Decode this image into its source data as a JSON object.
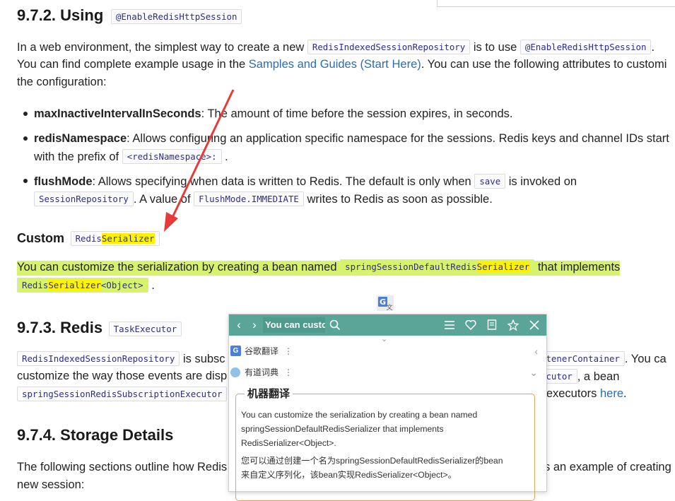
{
  "doc": {
    "h_972_prefix": "9.7.2. Using",
    "h_972_code": "@EnableRedisHttpSession",
    "p1_a": "In a web environment, the simplest way to create a new",
    "p1_code1": "RedisIndexedSessionRepository",
    "p1_b": "is to use",
    "p1_code2": "@EnableRedisHttpSession",
    "p1_c": ".",
    "p1_line2_a": "You can find complete example usage in the",
    "p1_link": "Samples and Guides (Start Here)",
    "p1_line2_b": ". You can use the following attributes to customi",
    "p1_line3": "the configuration:",
    "b1_bold": "maxInactiveIntervalInSeconds",
    "b1_text": ": The amount of time before the session expires, in seconds.",
    "b2_bold": "redisNamespace",
    "b2_text": ": Allows configuring an application specific namespace for the sessions. Redis keys and channel IDs start",
    "b2_line2_a": "with the prefix of",
    "b2_code": "<redisNamespace>:",
    "b2_line2_b": ".",
    "b3_bold": "flushMode",
    "b3_text": ": Allows specifying when data is written to Redis. The default is only when",
    "b3_code1": "save",
    "b3_text2": "is invoked on",
    "b3_code2": "SessionRepository",
    "b3_line2_a": ". A value of",
    "b3_code3": "FlushMode.IMMEDIATE",
    "b3_line2_b": "writes to Redis as soon as possible.",
    "h_custom": "Custom",
    "h_custom_code_a": "Redis",
    "h_custom_code_b": "Serializer",
    "p2_a": "You can customize the serialization by creating a bean named",
    "p2_code1_a": "springSessionDefaultRedis",
    "p2_code1_b": "Serializer",
    "p2_b": "that implements",
    "p2_code2_a": "Redis",
    "p2_code2_b": "Serializer",
    "p2_code2_c": "<Object>",
    "p2_c": ".",
    "h_973_prefix": "9.7.3. Redis",
    "h_973_code": "TaskExecutor",
    "p3_code1": "RedisIndexedSessionRepository",
    "p3_a": "is subsc",
    "p3_code_r": "stenerContainer",
    "p3_b": ". You ca",
    "p3_line2": "customize the way those events are disp",
    "p3_code_r2": "ecutor",
    "p3_line2_b": ", a bean",
    "p3_code2": "springSessionRedisSubscriptionExecutor",
    "p3_line3_b": "k executors",
    "p3_link": "here",
    "p3_line3_c": ".",
    "h_974": "9.7.4. Storage Details",
    "p4_a": "The following sections outline how Redis",
    "p4_b": "s an example of creating",
    "p4_line2": "new session:"
  },
  "popup": {
    "search_text": "You can custo",
    "source1": "谷歌翻译",
    "source2": "有道词典",
    "mt_title": "机器翻译",
    "en_text_1": "You can customize the serialization by creating a bean named",
    "en_text_2": "springSessionDefaultRedisSerializer that implements",
    "en_text_3": "RedisSerializer<Object>.",
    "zh_text_1": "您可以通过创建一个名为springSessionDefaultRedisSerializer的bean",
    "zh_text_2": "来自定义序列化，该bean实现RedisSerializer<Object>。",
    "bar_color": "#5aa598",
    "icons": [
      "back-icon",
      "forward-icon",
      "search-icon",
      "menu-icon",
      "heart-icon",
      "bookmark-icon",
      "pin-icon",
      "close-icon"
    ]
  },
  "colors": {
    "highlight_green": "#d7f26c",
    "highlight_yellow": "#fff200",
    "arrow": "#e53b3b"
  }
}
